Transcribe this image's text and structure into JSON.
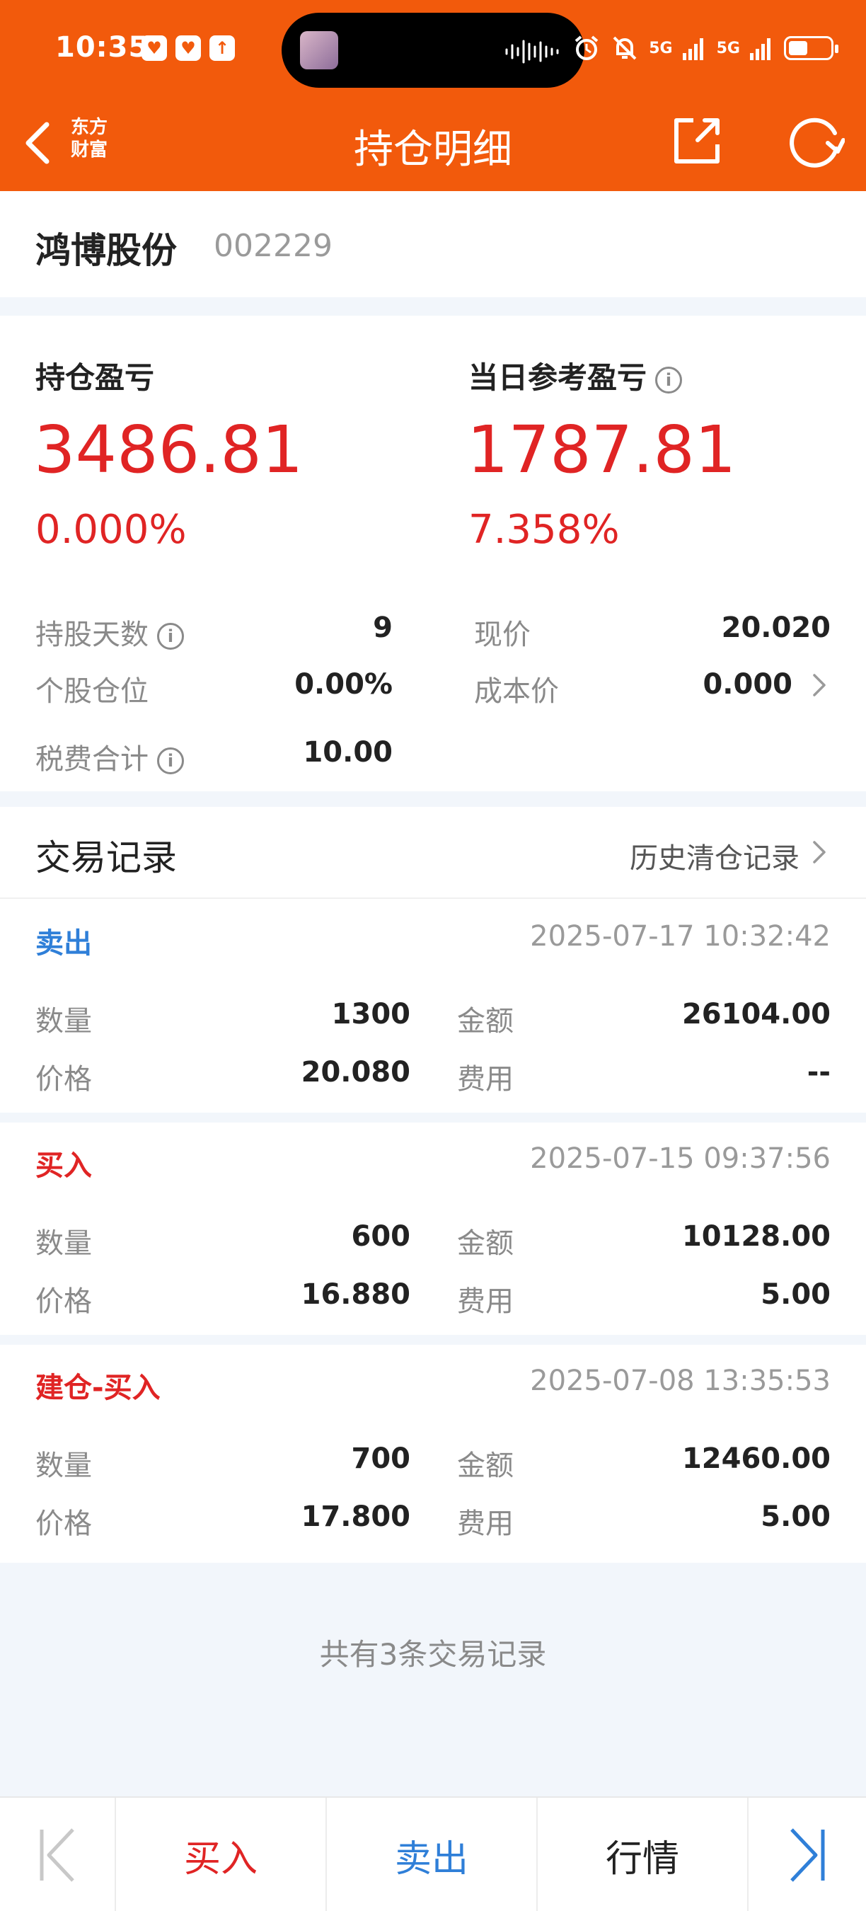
{
  "status_bar": {
    "time": "10:35",
    "net1": "5G",
    "net2": "5G"
  },
  "nav": {
    "logo_line1": "东方",
    "logo_line2": "财富",
    "title": "持仓明细"
  },
  "stock": {
    "name": "鸿博股份",
    "code": "002229"
  },
  "summary": {
    "position_pnl_label": "持仓盈亏",
    "position_pnl_value": "3486.81",
    "position_pnl_pct": "0.000%",
    "daily_pnl_label": "当日参考盈亏",
    "daily_pnl_value": "1787.81",
    "daily_pnl_pct": "7.358%",
    "hold_days_label": "持股天数",
    "hold_days_value": "9",
    "current_price_label": "现价",
    "current_price_value": "20.020",
    "position_ratio_label": "个股仓位",
    "position_ratio_value": "0.00%",
    "cost_price_label": "成本价",
    "cost_price_value": "0.000",
    "tax_total_label": "税费合计",
    "tax_total_value": "10.00",
    "info_glyph": "i"
  },
  "records": {
    "title": "交易记录",
    "history_link": "历史清仓记录",
    "qty_label": "数量",
    "amount_label": "金额",
    "price_label": "价格",
    "fee_label": "费用",
    "items": [
      {
        "type": "卖出",
        "time": "2025-07-17 10:32:42",
        "qty": "1300",
        "amount": "26104.00",
        "price": "20.080",
        "fee": "--"
      },
      {
        "type": "买入",
        "time": "2025-07-15 09:37:56",
        "qty": "600",
        "amount": "10128.00",
        "price": "16.880",
        "fee": "5.00"
      },
      {
        "type": "建仓-买入",
        "time": "2025-07-08 13:35:53",
        "qty": "700",
        "amount": "12460.00",
        "price": "17.800",
        "fee": "5.00"
      }
    ],
    "count_text": "共有3条交易记录"
  },
  "bottom_bar": {
    "buy": "买入",
    "sell": "卖出",
    "quote": "行情"
  },
  "colors": {
    "brand": "#f25a0c",
    "red": "#e02424",
    "blue": "#2f7fd8",
    "gray": "#8a8a8a"
  }
}
